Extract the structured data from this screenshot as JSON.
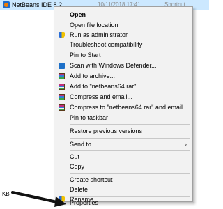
{
  "explorer": {
    "file_name": "NetBeans IDE 8.2",
    "date_modified": "10/11/2018 17:41",
    "file_type": "Shortcut",
    "size_unit": "KB"
  },
  "menu": {
    "open": "Open",
    "open_file_location": "Open file location",
    "run_as_administrator": "Run as administrator",
    "troubleshoot_compatibility": "Troubleshoot compatibility",
    "pin_to_start": "Pin to Start",
    "scan_with_defender": "Scan with Windows Defender...",
    "add_to_archive": "Add to archive...",
    "add_to_rar": "Add to \"netbeans64.rar\"",
    "compress_and_email": "Compress and email...",
    "compress_to_rar_and_email": "Compress to \"netbeans64.rar\" and email",
    "pin_to_taskbar": "Pin to taskbar",
    "restore_previous_versions": "Restore previous versions",
    "send_to": "Send to",
    "cut": "Cut",
    "copy": "Copy",
    "create_shortcut": "Create shortcut",
    "delete": "Delete",
    "rename": "Rename",
    "properties": "Properties"
  },
  "icons": {
    "shield": "uac-shield-icon",
    "defender": "windows-defender-icon",
    "rar": "winrar-icon",
    "submenu": "chevron-right-icon"
  },
  "colors": {
    "menu_background": "#f2f2f2",
    "selected_row": "#cce8ff",
    "annotation_arrow": "#111111"
  }
}
